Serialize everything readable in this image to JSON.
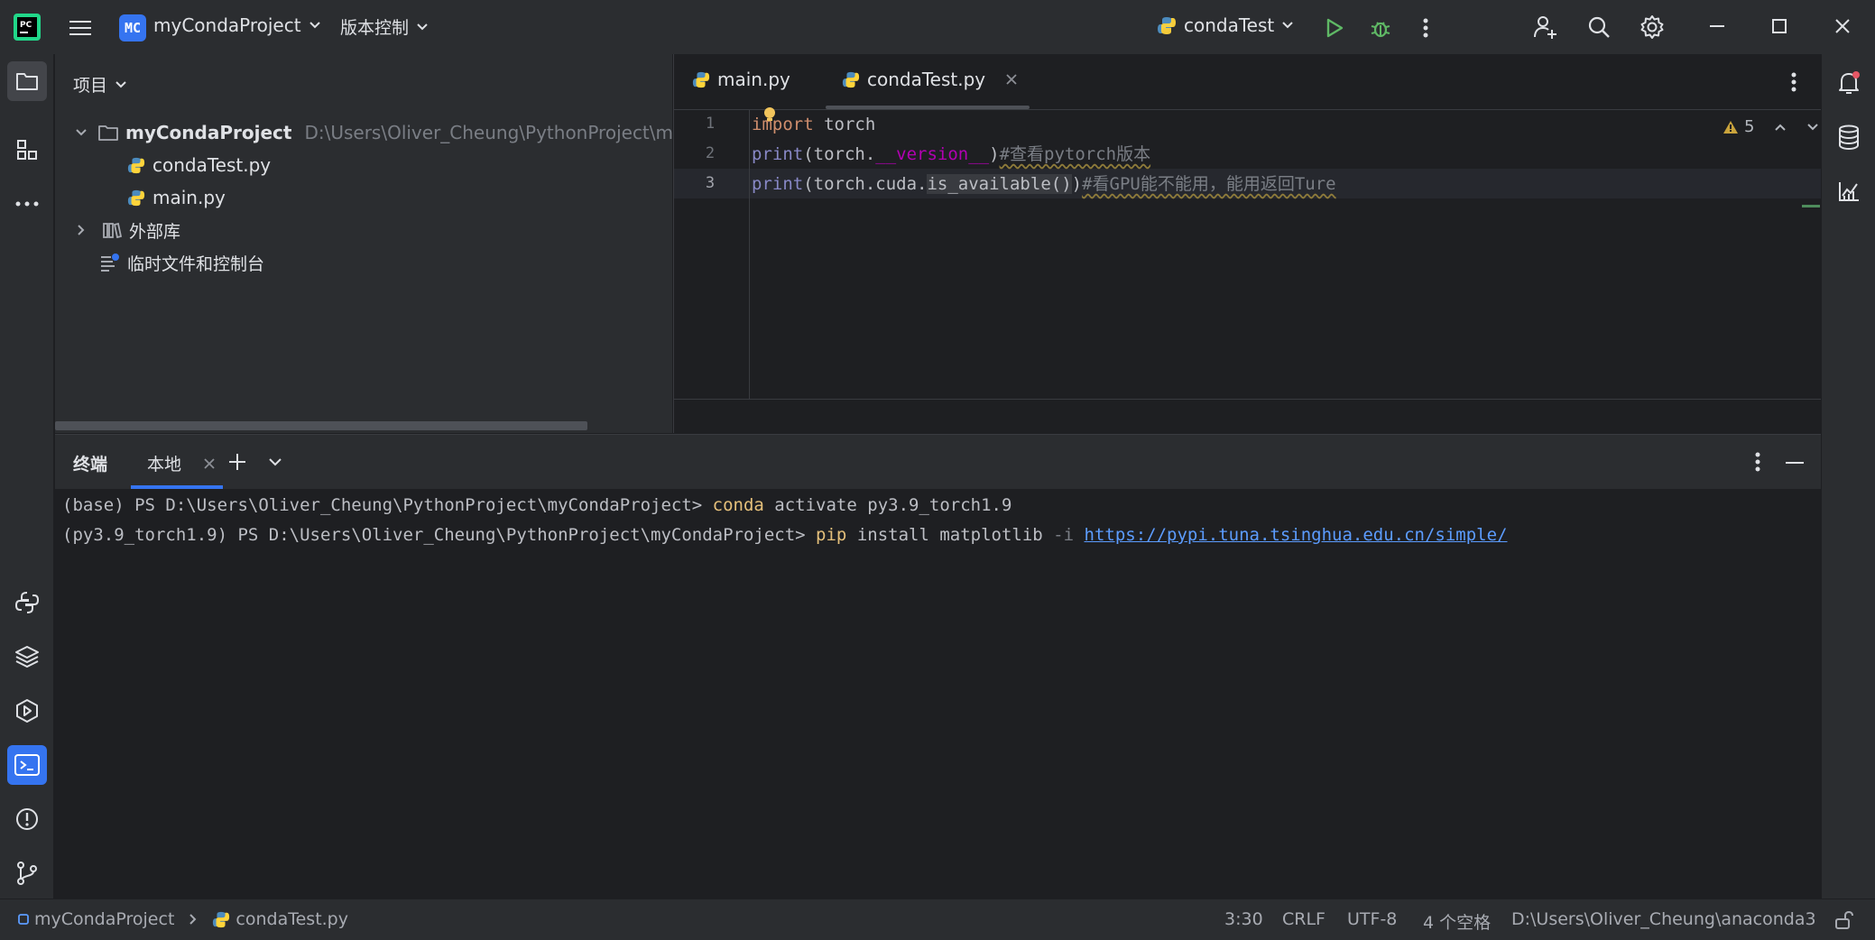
{
  "titlebar": {
    "project_badge": "MC",
    "project_name": "myCondaProject",
    "vcs_label": "版本控制",
    "run_config": "condaTest"
  },
  "project_panel": {
    "header": "项目",
    "root_name": "myCondaProject",
    "root_path": "D:\\Users\\Oliver_Cheung\\PythonProject\\myCon",
    "files": [
      "condaTest.py",
      "main.py"
    ],
    "external_libs": "外部库",
    "scratches": "临时文件和控制台"
  },
  "editor": {
    "tabs": [
      "main.py",
      "condaTest.py"
    ],
    "active_tab": "condaTest.py",
    "line_numbers": [
      "1",
      "2",
      "3"
    ],
    "lines": {
      "l1_kw": "import",
      "l1_rest": " torch",
      "l2_fn": "print",
      "l2_a": "(torch.",
      "l2_dunder": "__version__",
      "l2_b": ")",
      "l2_cmt": "#查看pytorch版本",
      "l3_fn": "print",
      "l3_a": "(torch.cuda.",
      "l3_hl": "is_available()",
      "l3_b": ")",
      "l3_cmt": "#看GPU能不能用，能用返回Ture"
    },
    "warning_count": "5"
  },
  "terminal": {
    "title": "终端",
    "tab_label": "本地",
    "line1_prompt": "(base) PS D:\\Users\\Oliver_Cheung\\PythonProject\\myCondaProject> ",
    "line1_cmd": "conda",
    "line1_rest": " activate py3.9_torch1.9",
    "line2_prompt": "(py3.9_torch1.9) PS D:\\Users\\Oliver_Cheung\\PythonProject\\myCondaProject> ",
    "line2_cmd": "pip",
    "line2_rest": " install matplotlib ",
    "line2_flag": "-i",
    "line2_url": "https://pypi.tuna.tsinghua.edu.cn/simple/"
  },
  "statusbar": {
    "breadcrumb_project": "myCondaProject",
    "breadcrumb_file": "condaTest.py",
    "position": "3:30",
    "line_sep": "CRLF",
    "encoding": "UTF-8",
    "indent": "4 个空格",
    "interpreter": "D:\\Users\\Oliver_Cheung\\anaconda3"
  },
  "colors": {
    "accent": "#3574f0",
    "run_green": "#5fb865",
    "terminal_cmd": "#e5c07b",
    "link": "#5c9cff"
  }
}
